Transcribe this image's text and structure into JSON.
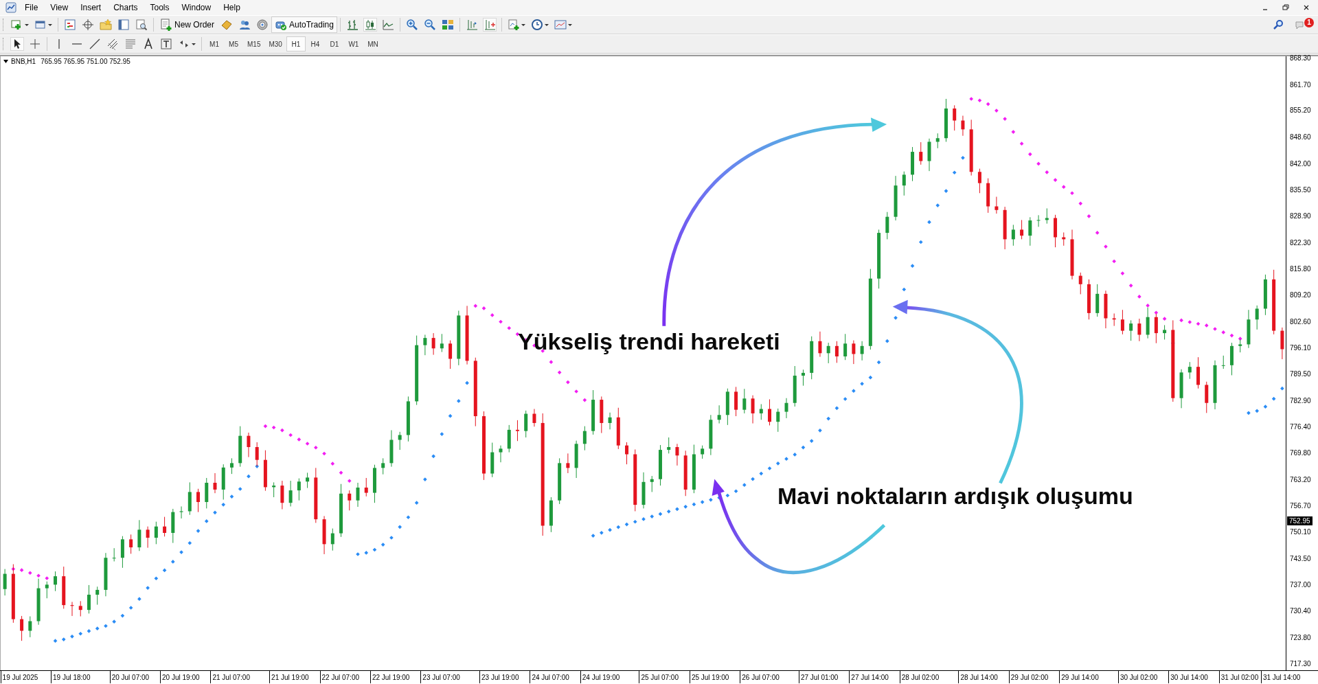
{
  "menu": [
    {
      "label": "File"
    },
    {
      "label": "View"
    },
    {
      "label": "Insert"
    },
    {
      "label": "Charts"
    },
    {
      "label": "Tools"
    },
    {
      "label": "Window"
    },
    {
      "label": "Help"
    }
  ],
  "toolbar": {
    "new_order": "New Order",
    "auto_trading": "AutoTrading",
    "notification_count": "1"
  },
  "timeframes": [
    {
      "label": "M1",
      "selected": false
    },
    {
      "label": "M5",
      "selected": false
    },
    {
      "label": "M15",
      "selected": false
    },
    {
      "label": "M30",
      "selected": false
    },
    {
      "label": "H1",
      "selected": true
    },
    {
      "label": "H4",
      "selected": false
    },
    {
      "label": "D1",
      "selected": false
    },
    {
      "label": "W1",
      "selected": false
    },
    {
      "label": "MN",
      "selected": false
    }
  ],
  "chart": {
    "symbol": "BNB,H1",
    "ohlc": "765.95 765.95 751.00 752.95",
    "current_price": "752.95",
    "chart_data": {
      "type": "candlestick",
      "ylim": [
        715.76,
        868.81
      ],
      "categories": [
        null,
        null,
        "19 Jul 2025",
        null,
        null,
        null,
        null,
        null,
        "19 Jul 18:00",
        null,
        null,
        null,
        null,
        null,
        null,
        "20 Jul 07:00",
        null,
        null,
        null,
        null,
        null,
        "20 Jul 19:00",
        null,
        null,
        null,
        null,
        null,
        "21 Jul 07:00",
        null,
        null,
        null,
        null,
        null,
        null,
        "21 Jul 19:00",
        null,
        null,
        null,
        null,
        null,
        "22 Jul 07:00",
        null,
        null,
        null,
        null,
        null,
        "22 Jul 19:00",
        null,
        null,
        null,
        null,
        null,
        "23 Jul 07:00",
        null,
        null,
        null,
        null,
        null,
        null,
        "23 Jul 19:00",
        null,
        null,
        null,
        null,
        null,
        "24 Jul 07:00",
        null,
        null,
        null,
        null,
        null,
        "24 Jul 19:00",
        null,
        null,
        null,
        null,
        null,
        null,
        "25 Jul 07:00",
        null,
        null,
        null,
        null,
        null,
        "25 Jul 19:00",
        null,
        null,
        null,
        null,
        null,
        "26 Jul 07:00",
        null,
        null,
        null,
        null,
        null,
        null,
        "27 Jul 01:00",
        null,
        null,
        null,
        null,
        null,
        "27 Jul 14:00",
        null,
        null,
        null,
        null,
        null,
        "28 Jul 02:00",
        null,
        null,
        null,
        null,
        null,
        null,
        "28 Jul 14:00",
        null,
        null,
        null,
        null,
        null,
        "29 Jul 02:00",
        null,
        null,
        null,
        null,
        null,
        "29 Jul 14:00",
        null,
        null,
        null,
        null,
        null,
        null,
        "30 Jul 02:00",
        null,
        null,
        null,
        null,
        null,
        "30 Jul 14:00",
        null,
        null,
        null,
        null,
        null,
        "31 Jul 02:00",
        null,
        null,
        null,
        null,
        "31 Jul 14:00"
      ],
      "ohlc": [
        [
          736,
          741.0,
          734.4,
          739.8
        ],
        [
          739.8,
          742.2,
          727.6,
          728.5
        ],
        [
          728.5,
          729.3,
          723.1,
          725.6
        ],
        [
          725.6,
          729.2,
          724.0,
          728
        ],
        [
          728,
          738.6,
          727.1,
          736.2
        ],
        [
          736.2,
          737.9,
          733.7,
          737.1
        ],
        [
          737.1,
          740.4,
          735.5,
          739.2
        ],
        [
          739.2,
          741.6,
          731.1,
          732
        ],
        [
          732,
          732.8,
          729.3,
          731.8
        ],
        [
          731.8,
          733.0,
          729.2,
          730.8
        ],
        [
          730.8,
          737.0,
          729.9,
          734.6
        ],
        [
          734.6,
          736.6,
          732.1,
          735.8
        ],
        [
          735.8,
          745.0,
          734.2,
          743.8
        ],
        [
          743.8,
          746.2,
          742.9,
          743.8
        ],
        [
          743.8,
          749.2,
          741.3,
          748.4
        ],
        [
          748.4,
          749.6,
          744.8,
          746.4
        ],
        [
          746.4,
          753.2,
          745.5,
          750.8
        ],
        [
          750.8,
          751.6,
          746.3,
          748.8
        ],
        [
          748.8,
          752.8,
          747.2,
          751.6
        ],
        [
          751.6,
          754.0,
          749.1,
          750
        ],
        [
          750,
          756.0,
          747.5,
          755.2
        ],
        [
          755.2,
          756.6,
          753.6,
          755.4
        ],
        [
          755.4,
          762.6,
          754.5,
          760.2
        ],
        [
          760.2,
          761.0,
          755.2,
          757.7
        ],
        [
          757.7,
          763.7,
          756.1,
          762.5
        ],
        [
          762.5,
          764.9,
          759.9,
          760.8
        ],
        [
          760.8,
          767.1,
          758.3,
          766.3
        ],
        [
          766.3,
          768.6,
          764.7,
          767.4
        ],
        [
          767.4,
          776.6,
          766.5,
          774.2
        ],
        [
          774.2,
          775.0,
          768.9,
          771.4
        ],
        [
          771.4,
          772.6,
          766.6,
          768.2
        ],
        [
          768.2,
          770.6,
          760.5,
          761.4
        ],
        [
          761.4,
          762.6,
          758.9,
          761.8
        ],
        [
          761.8,
          763.0,
          755.9,
          757.5
        ],
        [
          757.5,
          763.0,
          756.6,
          760.6
        ],
        [
          760.6,
          763.6,
          758.1,
          762.8
        ],
        [
          762.8,
          765.0,
          761.2,
          763.8
        ],
        [
          763.8,
          766.2,
          752.5,
          753.4
        ],
        [
          753.4,
          754.2,
          744.7,
          747.2
        ],
        [
          747.2,
          751.1,
          745.6,
          749.9
        ],
        [
          749.9,
          762.2,
          749.0,
          759.8
        ],
        [
          759.8,
          760.6,
          755.6,
          758.1
        ],
        [
          758.1,
          762.5,
          756.5,
          761.3
        ],
        [
          761.3,
          763.7,
          759.1,
          760
        ],
        [
          760,
          767.0,
          757.5,
          766.2
        ],
        [
          766.2,
          768.6,
          764.6,
          767.4
        ],
        [
          767.4,
          775.6,
          766.5,
          773.2
        ],
        [
          773.2,
          775.2,
          770.7,
          774.4
        ],
        [
          774.4,
          784.0,
          772.8,
          782.8
        ],
        [
          782.8,
          799.2,
          781.9,
          796.8
        ],
        [
          796.8,
          799.4,
          794.3,
          798.6
        ],
        [
          798.6,
          799.8,
          794.4,
          796
        ],
        [
          796,
          799.6,
          795.1,
          797.2
        ],
        [
          797.2,
          798.0,
          790.9,
          793.4
        ],
        [
          793.4,
          805.4,
          791.8,
          804.2
        ],
        [
          804.2,
          806.6,
          792.0,
          792.9
        ],
        [
          792.9,
          793.7,
          776.6,
          779.1
        ],
        [
          779.1,
          780.3,
          763.2,
          764.8
        ],
        [
          764.8,
          772.5,
          763.9,
          770.1
        ],
        [
          770.1,
          771.8,
          767.6,
          771
        ],
        [
          771,
          776.9,
          770.1,
          775.7
        ],
        [
          775.7,
          778.1,
          772.9,
          775.4
        ],
        [
          775.4,
          780.5,
          773.8,
          779.7
        ],
        [
          779.7,
          780.9,
          776.5,
          777.4
        ],
        [
          777.4,
          779.8,
          749.3,
          751.8
        ],
        [
          751.8,
          758.9,
          750.2,
          758.1
        ],
        [
          758.1,
          768.6,
          757.2,
          767.4
        ],
        [
          767.4,
          769.8,
          764.9,
          766.2
        ],
        [
          766.2,
          773.0,
          763.7,
          772.2
        ],
        [
          772.2,
          776.6,
          770.6,
          775.4
        ],
        [
          775.4,
          785.6,
          774.5,
          783.2
        ],
        [
          783.2,
          784.0,
          774.9,
          777.4
        ],
        [
          777.4,
          780.0,
          775.8,
          778.8
        ],
        [
          778.8,
          781.2,
          770.9,
          771.8
        ],
        [
          771.8,
          772.6,
          767.1,
          769.6
        ],
        [
          769.6,
          770.8,
          755.4,
          757
        ],
        [
          757,
          765.1,
          756.1,
          762.7
        ],
        [
          762.7,
          764.2,
          760.2,
          763.4
        ],
        [
          763.4,
          771.9,
          761.8,
          770.7
        ],
        [
          770.7,
          773.8,
          769.8,
          771.4
        ],
        [
          771.4,
          772.2,
          766.8,
          769.3
        ],
        [
          769.3,
          770.5,
          759.2,
          760.8
        ],
        [
          760.8,
          772.0,
          759.9,
          769.6
        ],
        [
          769.6,
          771.8,
          768.5,
          771
        ],
        [
          771,
          779.4,
          769.4,
          778.2
        ],
        [
          778.2,
          781.8,
          777.3,
          779.4
        ],
        [
          779.4,
          786.0,
          776.9,
          785.2
        ],
        [
          785.2,
          786.4,
          779.1,
          780.7
        ],
        [
          780.7,
          785.9,
          779.8,
          783.5
        ],
        [
          783.5,
          784.3,
          777.3,
          779.8
        ],
        [
          779.8,
          782.1,
          778.2,
          780.9
        ],
        [
          780.9,
          783.3,
          776.8,
          777.7
        ],
        [
          777.7,
          781.0,
          775.2,
          780.2
        ],
        [
          780.2,
          783.6,
          778.6,
          782.4
        ],
        [
          782.4,
          791.6,
          781.5,
          789.2
        ],
        [
          789.2,
          790.7,
          786.7,
          789.9
        ],
        [
          789.9,
          799.0,
          788.3,
          797.8
        ],
        [
          797.8,
          800.2,
          793.9,
          794.8
        ],
        [
          794.8,
          797.4,
          792.3,
          796.6
        ],
        [
          796.6,
          797.8,
          792.4,
          794
        ],
        [
          794,
          799.6,
          793.1,
          797.2
        ],
        [
          797.2,
          798.0,
          792.1,
          794.6
        ],
        [
          794.6,
          797.8,
          793.0,
          796.6
        ],
        [
          796.6,
          815.8,
          795.7,
          813.4
        ],
        [
          813.4,
          825.6,
          810.9,
          824.8
        ],
        [
          824.8,
          830.0,
          823.2,
          828.8
        ],
        [
          828.8,
          839.0,
          827.9,
          836.6
        ],
        [
          836.6,
          840.1,
          834.1,
          839.3
        ],
        [
          839.3,
          846.2,
          837.7,
          845
        ],
        [
          845,
          847.4,
          841.8,
          842.7
        ],
        [
          842.7,
          848.3,
          840.2,
          847.5
        ],
        [
          847.5,
          849.6,
          845.9,
          848.4
        ],
        [
          848.4,
          858.2,
          847.5,
          855.8
        ],
        [
          855.8,
          856.6,
          850.3,
          852.8
        ],
        [
          852.8,
          854.0,
          849.0,
          850.6
        ],
        [
          850.6,
          853.0,
          839.1,
          840
        ],
        [
          840,
          840.8,
          834.7,
          837.2
        ],
        [
          837.2,
          838.4,
          829.8,
          831.4
        ],
        [
          831.4,
          833.8,
          829.6,
          830.5
        ],
        [
          830.5,
          831.3,
          820.7,
          823.2
        ],
        [
          823.2,
          826.8,
          821.6,
          825.6
        ],
        [
          825.6,
          828.0,
          823.2,
          824.1
        ],
        [
          824.1,
          828.7,
          821.6,
          827.9
        ],
        [
          827.9,
          829.2,
          826.3,
          828
        ],
        [
          828,
          830.9,
          827.1,
          828.5
        ],
        [
          828.5,
          829.3,
          821.2,
          823.7
        ],
        [
          823.7,
          824.9,
          821.6,
          823.2
        ],
        [
          823.2,
          825.6,
          813.2,
          814.1
        ],
        [
          814.1,
          814.9,
          809.5,
          812
        ],
        [
          812,
          813.2,
          803.2,
          804.8
        ],
        [
          804.8,
          812.0,
          803.9,
          809.6
        ],
        [
          809.6,
          810.4,
          801.0,
          803.5
        ],
        [
          803.5,
          804.7,
          801.6,
          803.2
        ],
        [
          803.2,
          805.6,
          799.5,
          800.4
        ],
        [
          800.4,
          803.0,
          797.9,
          802.2
        ],
        [
          802.2,
          803.4,
          797.8,
          799.4
        ],
        [
          799.4,
          806.2,
          798.5,
          803.8
        ],
        [
          803.8,
          804.6,
          797.3,
          799.8
        ],
        [
          799.8,
          801.8,
          798.2,
          800.6
        ],
        [
          800.6,
          803.0,
          782.7,
          783.6
        ],
        [
          783.6,
          790.8,
          781.1,
          790
        ],
        [
          790,
          792.6,
          788.4,
          791.4
        ],
        [
          791.4,
          793.8,
          786.0,
          786.9
        ],
        [
          786.9,
          787.7,
          779.9,
          782.4
        ],
        [
          782.4,
          793.0,
          780.8,
          791.8
        ],
        [
          791.8,
          794.2,
          790.9,
          791.8
        ],
        [
          791.8,
          797.4,
          789.3,
          796.6
        ],
        [
          796.6,
          798.2,
          795.0,
          797
        ],
        [
          797,
          805.6,
          796.1,
          803.2
        ],
        [
          803.2,
          806.7,
          800.7,
          805.9
        ],
        [
          805.9,
          814.4,
          804.3,
          813.2
        ],
        [
          813.2,
          815.6,
          799.5,
          800.4
        ],
        [
          800.4,
          801.2,
          793.3,
          795.8
        ]
      ],
      "yticks": [
        {
          "value": 868.3,
          "label": "868.30"
        },
        {
          "value": 861.7,
          "label": "861.70"
        },
        {
          "value": 855.2,
          "label": "855.20"
        },
        {
          "value": 848.6,
          "label": "848.60"
        },
        {
          "value": 842,
          "label": "842.00"
        },
        {
          "value": 835.5,
          "label": "835.50"
        },
        {
          "value": 828.9,
          "label": "828.90"
        },
        {
          "value": 822.3,
          "label": "822.30"
        },
        {
          "value": 815.8,
          "label": "815.80"
        },
        {
          "value": 809.2,
          "label": "809.20"
        },
        {
          "value": 802.6,
          "label": "802.60"
        },
        {
          "value": 796.1,
          "label": "796.10"
        },
        {
          "value": 789.5,
          "label": "789.50"
        },
        {
          "value": 782.9,
          "label": "782.90"
        },
        {
          "value": 776.4,
          "label": "776.40"
        },
        {
          "value": 769.8,
          "label": "769.80"
        },
        {
          "value": 763.2,
          "label": "763.20"
        },
        {
          "value": 756.7,
          "label": "756.70"
        },
        {
          "value": 750.1,
          "label": "750.10"
        },
        {
          "value": 743.5,
          "label": "743.50"
        },
        {
          "value": 737,
          "label": "737.00"
        },
        {
          "value": 730.4,
          "label": "730.40"
        },
        {
          "value": 723.8,
          "label": "723.80"
        },
        {
          "value": 717.3,
          "label": "717.30"
        }
      ]
    },
    "annotations": [
      {
        "text": "Yükseliş trendi hareketi"
      },
      {
        "text": "Mavi noktaların ardışık oluşumu"
      }
    ]
  }
}
